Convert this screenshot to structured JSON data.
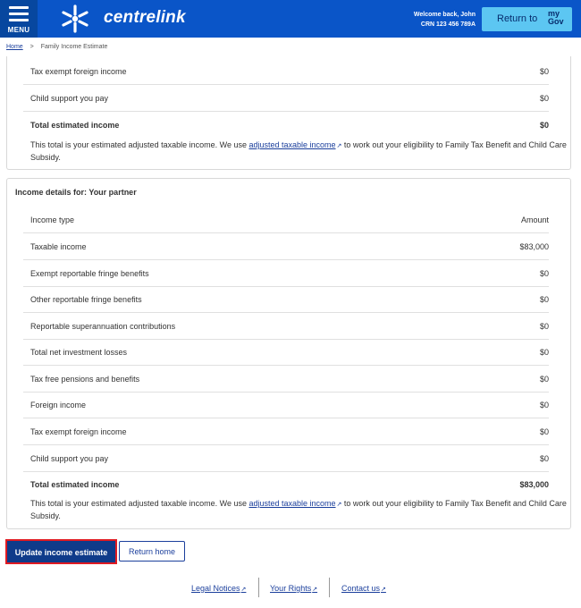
{
  "header": {
    "menu_label": "MENU",
    "brand": "centrelink",
    "welcome_line": "Welcome back, John",
    "crn_line": "CRN 123 456 789A",
    "return_label": "Return to",
    "mygov_top": "my",
    "mygov_bottom": "Gov",
    "colors": {
      "bar": "#0a55c8",
      "return_button": "#5cc6f2"
    }
  },
  "breadcrumb": {
    "home": "Home",
    "separator": ">",
    "current": "Family Income Estimate"
  },
  "section_self_tail": {
    "rows": [
      {
        "label": "Tax exempt foreign income",
        "amount": "$0"
      },
      {
        "label": "Child support you pay",
        "amount": "$0"
      },
      {
        "label": "Total estimated income",
        "amount": "$0"
      }
    ],
    "note_before": "This total is your estimated adjusted taxable income. We use ",
    "note_link": "adjusted taxable income",
    "note_after": " to work out your eligibility to Family Tax Benefit and Child Care Subsidy."
  },
  "section_partner": {
    "title": "Income details for: Your partner",
    "header": {
      "label": "Income type",
      "amount": "Amount"
    },
    "rows": [
      {
        "label": "Taxable income",
        "amount": "$83,000"
      },
      {
        "label": "Exempt reportable fringe benefits",
        "amount": "$0"
      },
      {
        "label": "Other reportable fringe benefits",
        "amount": "$0"
      },
      {
        "label": "Reportable superannuation contributions",
        "amount": "$0"
      },
      {
        "label": "Total net investment losses",
        "amount": "$0"
      },
      {
        "label": "Tax free pensions and benefits",
        "amount": "$0"
      },
      {
        "label": "Foreign income",
        "amount": "$0"
      },
      {
        "label": "Tax exempt foreign income",
        "amount": "$0"
      },
      {
        "label": "Child support you pay",
        "amount": "$0"
      }
    ],
    "total": {
      "label": "Total estimated income",
      "amount": "$83,000"
    },
    "note_before": "This total is your estimated adjusted taxable income. We use ",
    "note_link": "adjusted taxable income",
    "note_after": " to work out your eligibility to Family Tax Benefit and Child Care Subsidy."
  },
  "actions": {
    "update": "Update income estimate",
    "return_home": "Return home"
  },
  "footer": {
    "legal": "Legal Notices",
    "rights": "Your Rights",
    "contact": "Contact us"
  },
  "icons": {
    "menu": "menu-icon",
    "logo": "centrelink-star-icon",
    "external": "external-link-icon"
  }
}
